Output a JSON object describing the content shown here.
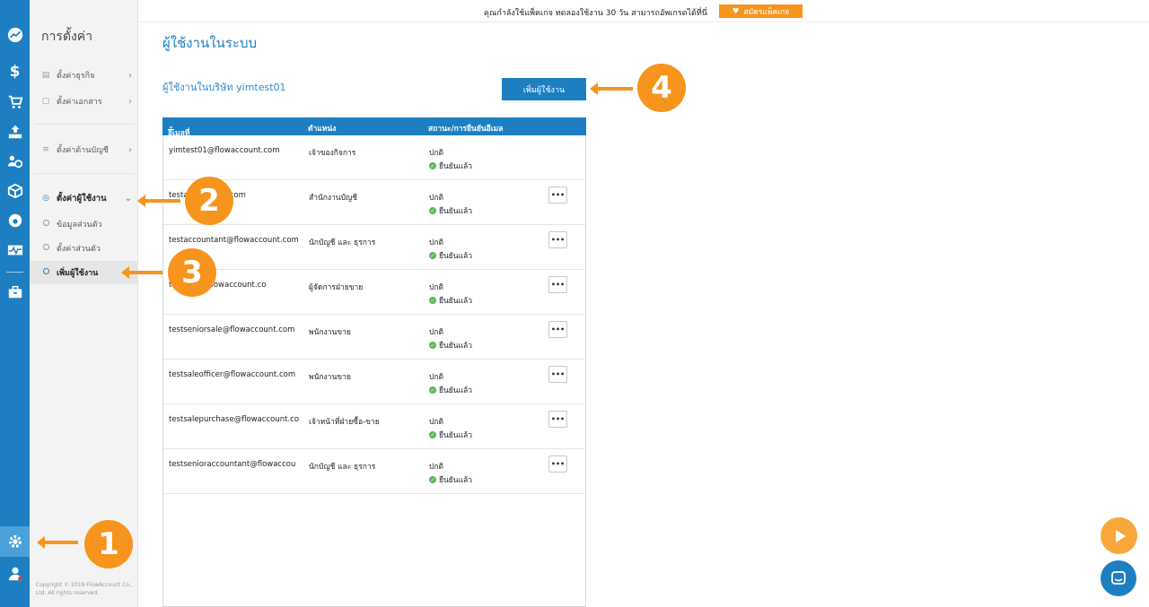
{
  "sidebar": {
    "title": "การตั้งค่า",
    "items": [
      {
        "label": "ตั้งค่าธุรกิจ"
      },
      {
        "label": "ตั้งค่าเอกสาร"
      },
      {
        "label": "ตั้งค่าด้านบัญชี"
      },
      {
        "label": "ตั้งค่าผู้ใช้งาน"
      },
      {
        "label": "ข้อมูลส่วนตัว"
      },
      {
        "label": "ตั้งค่าส่วนตัว"
      },
      {
        "label": "เพิ่มผู้ใช้งาน"
      }
    ],
    "copyright": "Copyright © 2018 FlowAccount Co., Ltd. All rights reserved."
  },
  "topbar": {
    "text": "คุณกำลังใช้แพ็คเกจ ทดลองใช้งาน 30 วัน สามารถอัพเกรดได้ที่นี่",
    "button_label": "สมัครแพ็คเกจ"
  },
  "page": {
    "title": "ผู้ใช้งานในระบบ",
    "company_label": "ผู้ใช้งานในบริษัท yimtest01",
    "add_user_button": "เพิ่มผู้ใช้งาน"
  },
  "table": {
    "headers": {
      "email": "อีเมลที่ใช้งานในระบบ/ชื่อนามสกุล",
      "position": "ตำแหน่ง",
      "status": "สถานะ/การยืนยันอีเมล"
    },
    "more_label": "•••",
    "rows": [
      {
        "email": "yimtest01@flowaccount.com",
        "position": "เจ้าของกิจการ",
        "status": "ปกติ",
        "confirm": "ยืนยันแล้ว"
      },
      {
        "email": "testa waccount.com",
        "position": "สำนักงานบัญชี",
        "status": "ปกติ",
        "confirm": "ยืนยันแล้ว"
      },
      {
        "email": "testaccountant@flowaccount.com",
        "position": "นักบัญชี และ ธุรการ",
        "status": "ปกติ",
        "confirm": "ยืนยันแล้ว"
      },
      {
        "email": "te nager@flowaccount.co",
        "position": "ผู้จัดการฝ่ายขาย",
        "status": "ปกติ",
        "confirm": "ยืนยันแล้ว"
      },
      {
        "email": "testseniorsale@flowaccount.com",
        "position": "พนักงานขาย",
        "status": "ปกติ",
        "confirm": "ยืนยันแล้ว"
      },
      {
        "email": "testsaleofficer@flowaccount.com",
        "position": "พนักงานขาย",
        "status": "ปกติ",
        "confirm": "ยืนยันแล้ว"
      },
      {
        "email": "testsalepurchase@flowaccount.co",
        "position": "เจ้าหน้าที่ฝ่ายซื้อ-ขาย",
        "status": "ปกติ",
        "confirm": "ยืนยันแล้ว"
      },
      {
        "email": "testsenioraccountant@flowaccou",
        "position": "นักบัญชี และ ธุรการ",
        "status": "ปกติ",
        "confirm": "ยืนยันแล้ว"
      }
    ]
  },
  "callouts": [
    "1",
    "2",
    "3",
    "4"
  ],
  "colors": {
    "primary": "#1d7fc2",
    "accent": "#f7941d"
  }
}
